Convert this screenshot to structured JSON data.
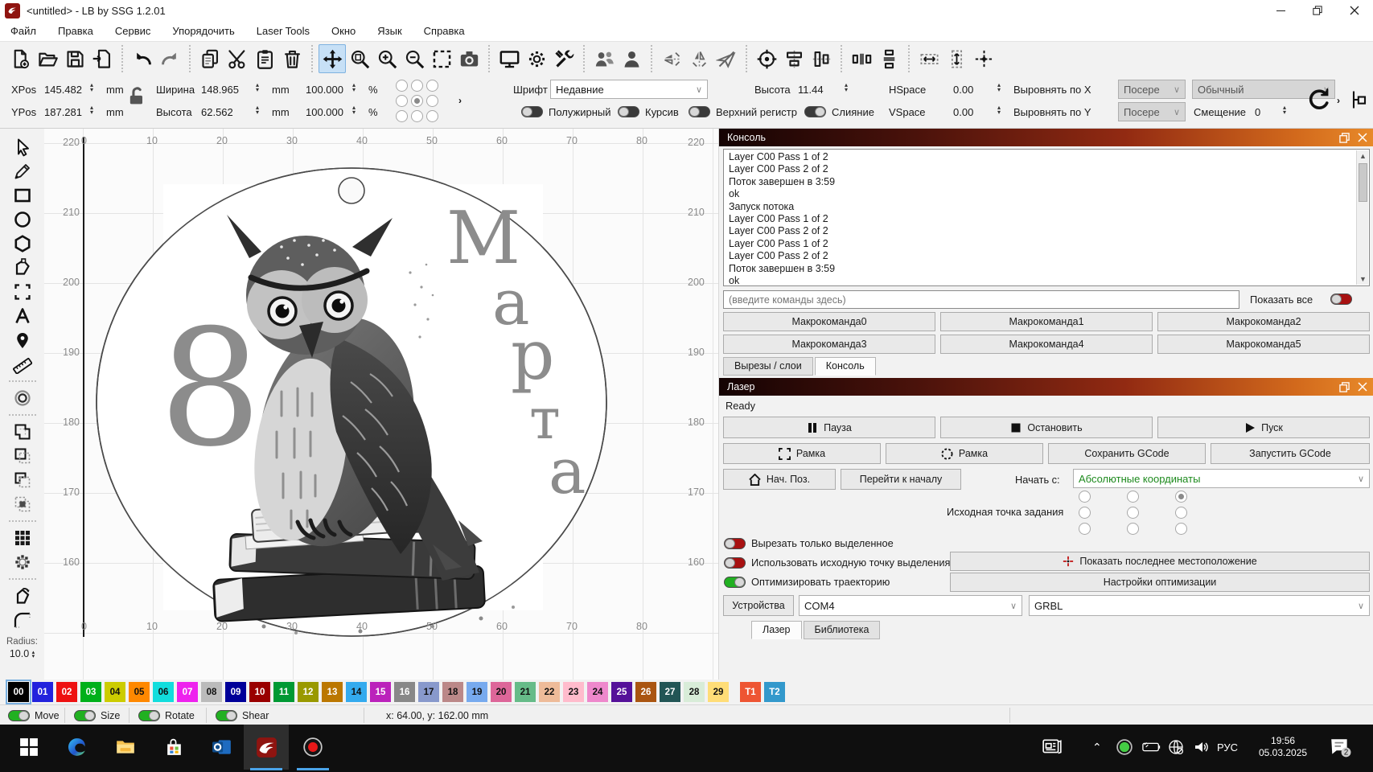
{
  "window": {
    "title": "<untitled> - LB by SSG 1.2.01"
  },
  "menu": {
    "items": [
      "Файл",
      "Правка",
      "Сервис",
      "Упорядочить",
      "Laser Tools",
      "Окно",
      "Язык",
      "Справка"
    ]
  },
  "toolbar": {
    "active_icon": "pan",
    "groups": [
      [
        "new-file",
        "open-file",
        "save-file",
        "import-file"
      ],
      [
        "undo",
        "redo"
      ],
      [
        "copy",
        "cut",
        "paste",
        "delete"
      ],
      [
        "pan",
        "zoom-page",
        "zoom-in",
        "zoom-out",
        "select-frame",
        "camera"
      ],
      [
        "monitor",
        "settings-gear",
        "tools-wrench"
      ],
      [
        "group-objects",
        "single-user"
      ],
      [
        "flip-vertical",
        "flip-horizontal",
        "mirror-across-line"
      ],
      [
        "focus-target",
        "align-objects-h",
        "align-objects-v"
      ],
      [
        "distribute-h",
        "distribute-v"
      ],
      [
        "resize-width",
        "resize-height",
        "move-to-position"
      ]
    ]
  },
  "position_bar": {
    "xpos_label": "XPos",
    "xpos_value": "145.482",
    "ypos_label": "YPos",
    "ypos_value": "187.281",
    "unit_mm": "mm",
    "width_label": "Ширина",
    "width_value": "148.965",
    "height_label": "Высота",
    "height_value": "62.562",
    "width_pct": "100.000",
    "height_pct": "100.000",
    "unit_pct": "%"
  },
  "font_bar": {
    "font_label": "Шрифт",
    "font_value": "Недавние",
    "height_label": "Высота",
    "height_value": "11.44",
    "hspace_label": "HSpace",
    "hspace_value": "0.00",
    "vspace_label": "VSpace",
    "vspace_value": "0.00",
    "align_x_label": "Выровнять по X",
    "align_x_value": "Посере",
    "style_value": "Обычный",
    "align_y_label": "Выровнять по Y",
    "align_y_value": "Посере",
    "offset_label": "Смещение",
    "offset_value": "0",
    "bold_label": "Полужирный",
    "italic_label": "Курсив",
    "upper_label": "Верхний регистр",
    "merge_label": "Слияние"
  },
  "canvas": {
    "h_ticks": [
      "0",
      "10",
      "20",
      "30",
      "40",
      "50",
      "60",
      "70",
      "80"
    ],
    "v_ticks": [
      "220",
      "210",
      "200",
      "190",
      "180",
      "170",
      "160"
    ],
    "design": {
      "number": "8",
      "letters": [
        "М",
        "а",
        "р",
        "т",
        "а"
      ]
    }
  },
  "left_toolbar": {
    "groups": [
      [
        "select",
        "draw-lines",
        "rectangle",
        "ellipse",
        "polygon",
        "edit-nodes",
        "frame-shape",
        "text",
        "position-laser",
        "measure"
      ],
      [
        "offset-shapes"
      ],
      [
        "weld-shapes",
        "boolean-subtract",
        "boolean-difference",
        "boolean-intersect"
      ],
      [
        "grid-array",
        "circular-array"
      ],
      [
        "warp-shape",
        "round-corners"
      ]
    ],
    "radius_label": "Radius:",
    "radius_value": "10.0"
  },
  "console": {
    "title": "Консоль",
    "lines": [
      "Layer C00 Pass 1 of 2",
      "Layer C00 Pass 2 of 2",
      "Поток завершен в 3:59",
      "ok",
      "Запуск потока",
      "Layer C00 Pass 1 of 2",
      "Layer C00 Pass 2 of 2",
      "Layer C00 Pass 1 of 2",
      "Layer C00 Pass 2 of 2",
      "Поток завершен в 3:59",
      "ok"
    ],
    "input_placeholder": "(введите команды здесь)",
    "show_all_label": "Показать все",
    "macros": [
      "Макрокоманда0",
      "Макрокоманда1",
      "Макрокоманда2",
      "Макрокоманда3",
      "Макрокоманда4",
      "Макрокоманда5"
    ],
    "tabs": [
      "Вырезы / слои",
      "Консоль"
    ],
    "active_tab": "Консоль"
  },
  "laser": {
    "title": "Лазер",
    "status": "Ready",
    "pause_label": "Пауза",
    "stop_label": "Остановить",
    "start_label": "Пуск",
    "frame_label": "Рамка",
    "frame_circle_label": "Рамка",
    "save_gcode_label": "Сохранить GCode",
    "run_gcode_label": "Запустить GCode",
    "home_label": "Нач. Поз.",
    "goto_origin_label": "Перейти к началу",
    "start_from_label": "Начать с:",
    "start_from_value": "Абсолютные координаты",
    "job_origin_label": "Исходная точка задания",
    "origin_selected_index": 2,
    "cut_selected_label": "Вырезать только выделенное",
    "use_selection_origin_label": "Использовать исходную точку выделения",
    "optimize_label": "Оптимизировать траекторию",
    "show_last_label": "Показать последнее местоположение",
    "opt_settings_label": "Настройки оптимизации",
    "devices_label": "Устройства",
    "port_value": "COM4",
    "device_value": "GRBL",
    "tabs": [
      "Лазер",
      "Библиотека"
    ],
    "active_tab": "Лазер"
  },
  "palette": {
    "selected_index": 0,
    "swatches": [
      {
        "label": "00",
        "color": "#000000"
      },
      {
        "label": "01",
        "color": "#2222dd"
      },
      {
        "label": "02",
        "color": "#ee1111"
      },
      {
        "label": "03",
        "color": "#00b01a"
      },
      {
        "label": "04",
        "color": "#cccc00"
      },
      {
        "label": "05",
        "color": "#ff8800"
      },
      {
        "label": "06",
        "color": "#11dddd"
      },
      {
        "label": "07",
        "color": "#ee22ee"
      },
      {
        "label": "08",
        "color": "#bbbbbb"
      },
      {
        "label": "09",
        "color": "#000099"
      },
      {
        "label": "10",
        "color": "#990000"
      },
      {
        "label": "11",
        "color": "#009933"
      },
      {
        "label": "12",
        "color": "#999900"
      },
      {
        "label": "13",
        "color": "#bb7700"
      },
      {
        "label": "14",
        "color": "#33aaee"
      },
      {
        "label": "15",
        "color": "#bb22bb"
      },
      {
        "label": "16",
        "color": "#888888"
      },
      {
        "label": "17",
        "color": "#8899cc"
      },
      {
        "label": "18",
        "color": "#bb8888"
      },
      {
        "label": "19",
        "color": "#77aaee"
      },
      {
        "label": "20",
        "color": "#dd6699"
      },
      {
        "label": "21",
        "color": "#66bb88"
      },
      {
        "label": "22",
        "color": "#eebb99"
      },
      {
        "label": "23",
        "color": "#ffbbcc"
      },
      {
        "label": "24",
        "color": "#ee88cc"
      },
      {
        "label": "25",
        "color": "#551199"
      },
      {
        "label": "26",
        "color": "#aa5511"
      },
      {
        "label": "27",
        "color": "#225555"
      },
      {
        "label": "28",
        "color": "#d8ecd8"
      },
      {
        "label": "29",
        "color": "#ffdd77"
      },
      {
        "label": "T1",
        "color": "#ee5533"
      },
      {
        "label": "T2",
        "color": "#3399cc"
      }
    ]
  },
  "statusbar": {
    "toggles": [
      "Move",
      "Size",
      "Rotate",
      "Shear"
    ],
    "coords": "x: 64.00, y: 162.00 mm"
  },
  "taskbar": {
    "language": "РУС",
    "time": "19:56",
    "date": "05.03.2025",
    "notification_count": "2"
  }
}
